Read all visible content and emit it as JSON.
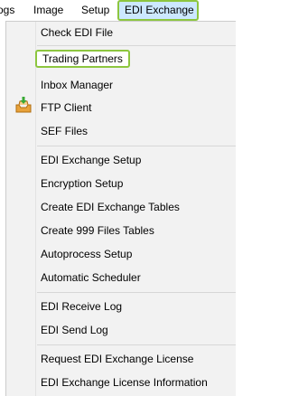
{
  "menubar": {
    "items": [
      {
        "label": "ogs"
      },
      {
        "label": "Image"
      },
      {
        "label": "Setup"
      },
      {
        "label": "EDI Exchange"
      }
    ]
  },
  "menu": {
    "items": [
      {
        "label": "Check EDI File"
      },
      {
        "label": "Trading Partners"
      },
      {
        "label": "Inbox Manager",
        "icon": "inbox-icon"
      },
      {
        "label": "FTP Client"
      },
      {
        "label": "SEF Files"
      },
      {
        "label": "EDI Exchange Setup"
      },
      {
        "label": "Encryption Setup"
      },
      {
        "label": "Create EDI Exchange Tables"
      },
      {
        "label": "Create 999 Files Tables"
      },
      {
        "label": "Autoprocess Setup"
      },
      {
        "label": "Automatic Scheduler"
      },
      {
        "label": "EDI Receive Log"
      },
      {
        "label": "EDI Send Log"
      },
      {
        "label": "Request EDI Exchange License"
      },
      {
        "label": "EDI Exchange License Information"
      }
    ]
  },
  "colors": {
    "highlight_border": "#8dc63f",
    "active_menu_bg": "#cce8ff",
    "menu_bg": "#f2f2f2"
  }
}
